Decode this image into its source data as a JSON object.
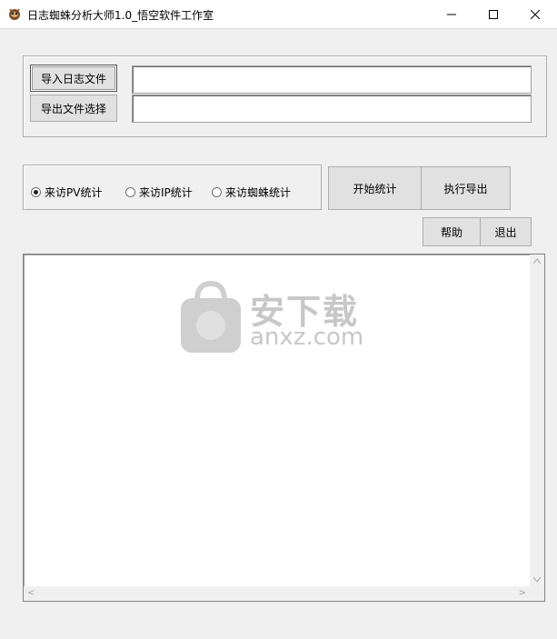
{
  "window": {
    "title": "日志蜘蛛分析大师1.0_悟空软件工作室",
    "icon": "spider-app-icon",
    "controls": [
      "minimize-icon",
      "maximize-icon",
      "close-icon"
    ]
  },
  "files": {
    "import_label": "导入日志文件",
    "export_label": "导出文件选择",
    "import_path": "",
    "export_path": ""
  },
  "stats": {
    "options": [
      {
        "label": "来访PV统计",
        "selected": true
      },
      {
        "label": "来访IP统计",
        "selected": false
      },
      {
        "label": "来访蜘蛛统计",
        "selected": false
      }
    ],
    "start_label": "开始统计",
    "export_run_label": "执行导出"
  },
  "actions": {
    "help_label": "帮助",
    "exit_label": "退出"
  },
  "output": {
    "text": "",
    "scroll_left_arrow": "<",
    "scroll_right_arrow": ">"
  },
  "watermark": {
    "cn": "安下载",
    "en": "anxz.com"
  }
}
